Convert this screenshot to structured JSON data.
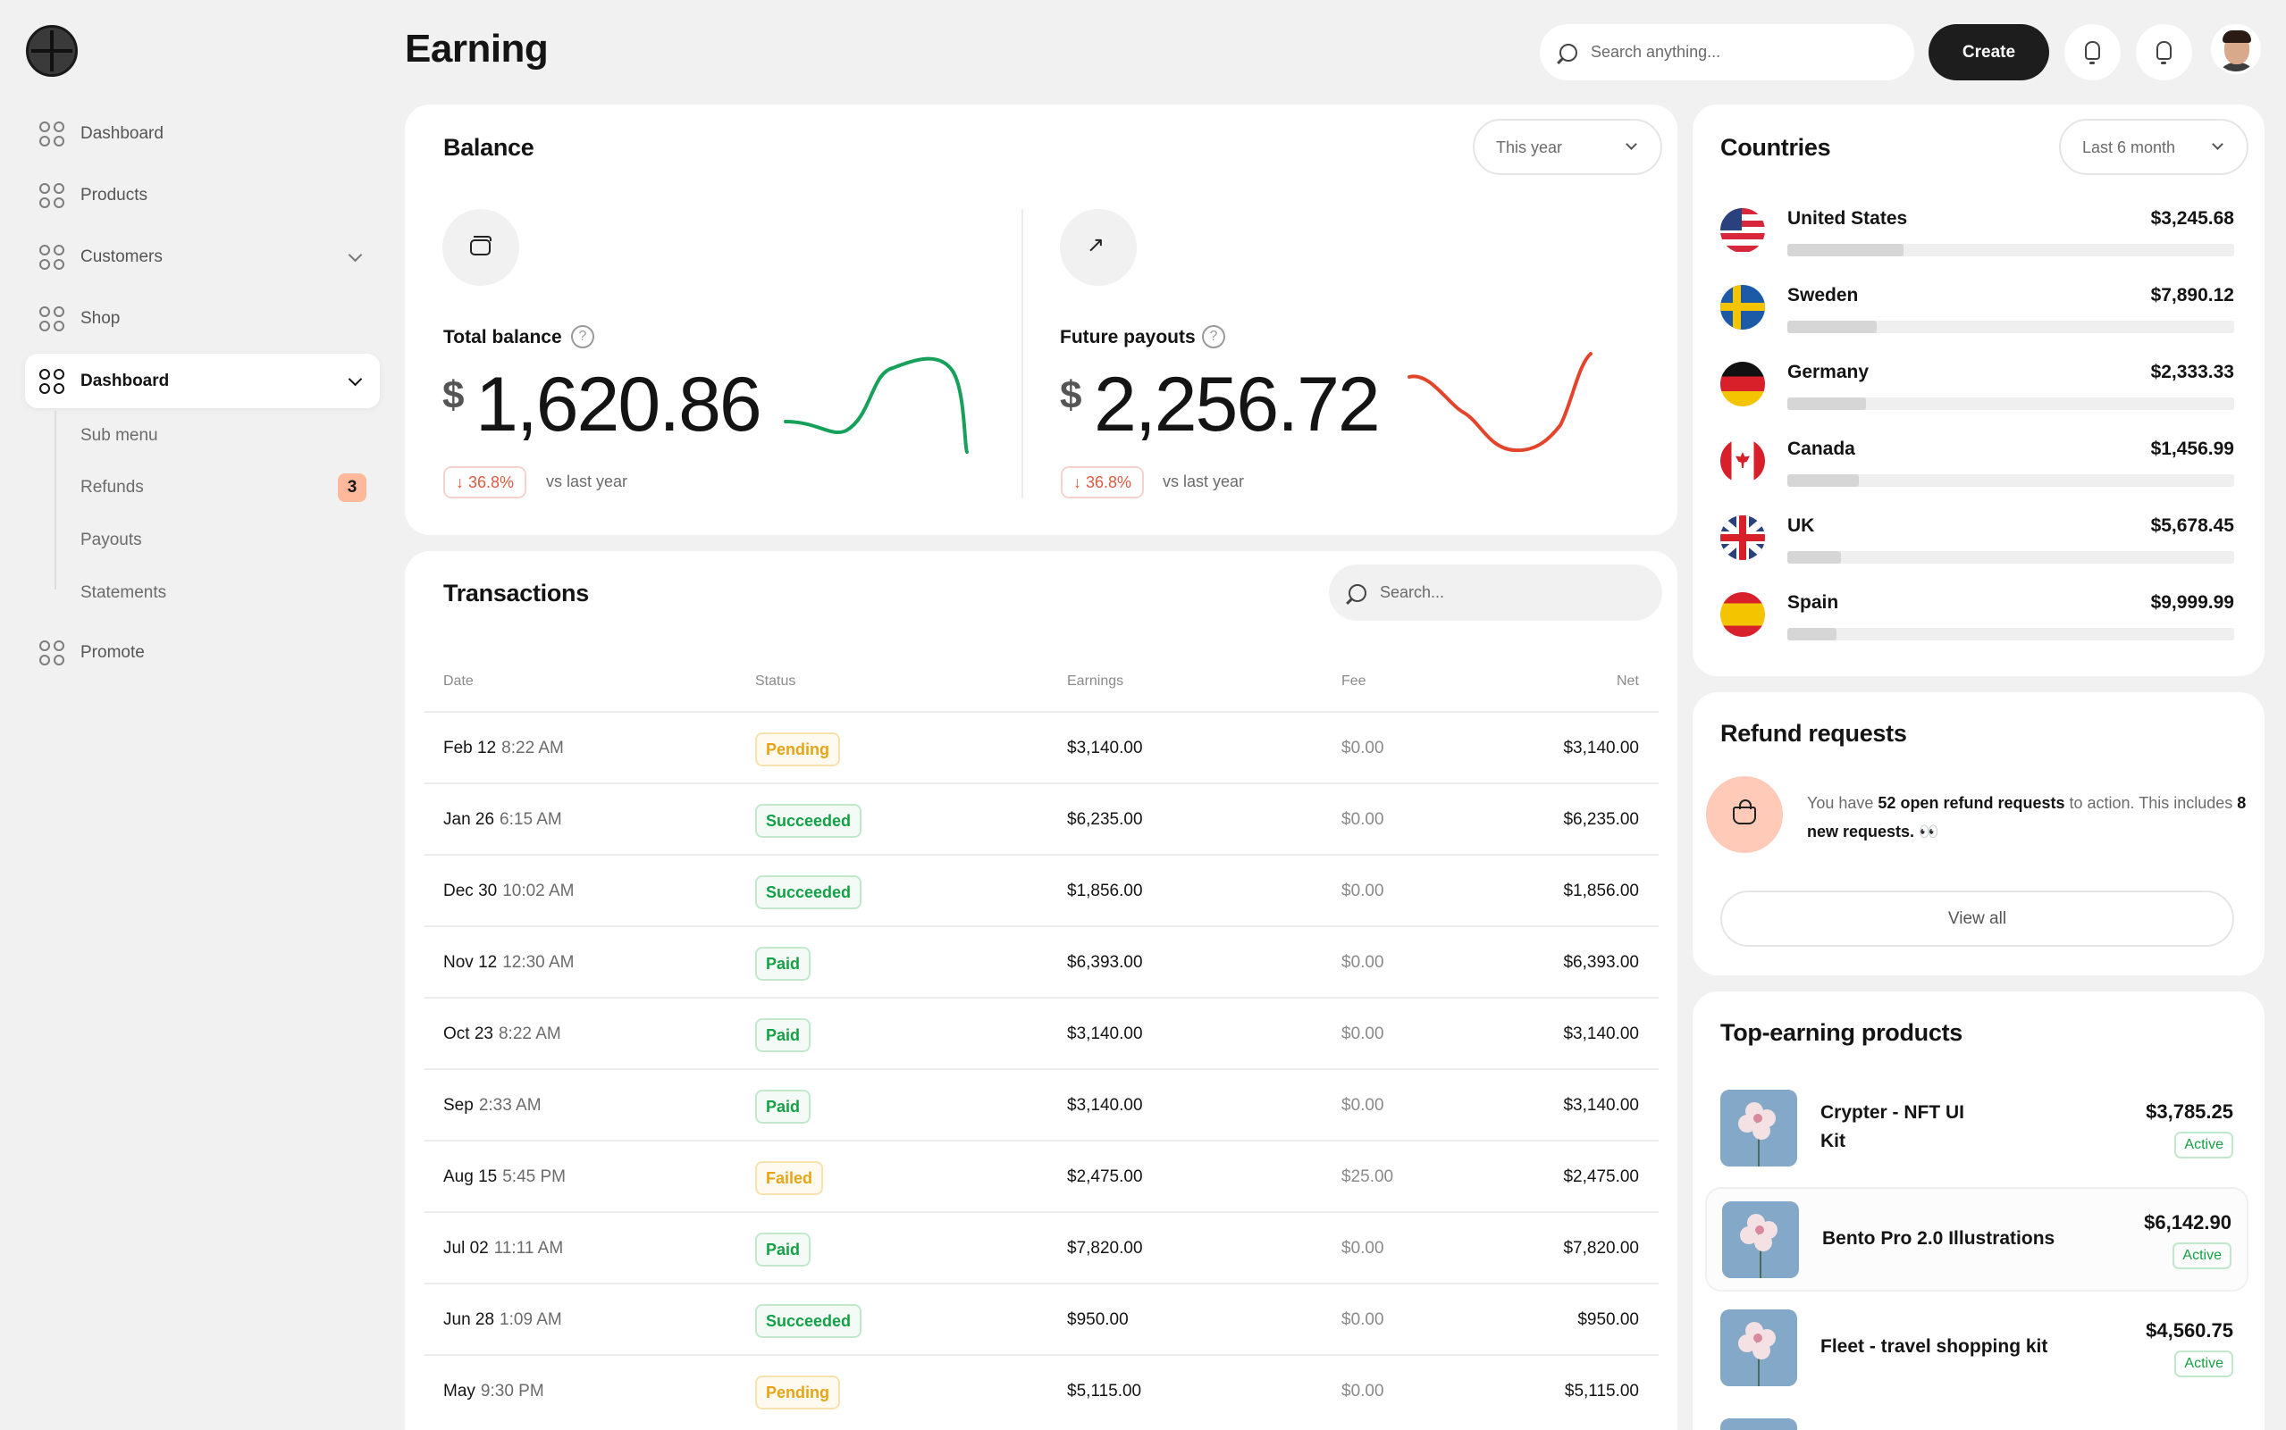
{
  "header": {
    "title": "Earning",
    "search_placeholder": "Search anything...",
    "create_label": "Create"
  },
  "sidebar": {
    "items": [
      {
        "label": "Dashboard"
      },
      {
        "label": "Products"
      },
      {
        "label": "Customers"
      },
      {
        "label": "Shop"
      },
      {
        "label": "Dashboard"
      },
      {
        "label": "Promote"
      }
    ],
    "sub_items": [
      {
        "label": "Sub menu"
      },
      {
        "label": "Refunds",
        "badge": "3"
      },
      {
        "label": "Payouts"
      },
      {
        "label": "Statements"
      }
    ]
  },
  "balance": {
    "title": "Balance",
    "period": "This year",
    "total": {
      "label": "Total balance",
      "currency": "$",
      "value": "1,620.86",
      "delta": "36.8%",
      "delta_arrow": "↓",
      "compare": "vs last year"
    },
    "future": {
      "label": "Future payouts",
      "currency": "$",
      "value": "2,256.72",
      "delta": "36.8%",
      "delta_arrow": "↓",
      "compare": "vs last year"
    },
    "colors": {
      "total_line": "#16a05a",
      "future_line": "#e3452c"
    }
  },
  "transactions": {
    "title": "Transactions",
    "search_placeholder": "Search...",
    "columns": [
      "Date",
      "Status",
      "Earnings",
      "Fee",
      "Net"
    ],
    "rows": [
      {
        "date": "Feb 12",
        "time": "8:22 AM",
        "status": "Pending",
        "kind": "pending",
        "earnings": "$3,140.00",
        "fee": "$0.00",
        "net": "$3,140.00"
      },
      {
        "date": "Jan 26",
        "time": "6:15 AM",
        "status": "Succeeded",
        "kind": "ok",
        "earnings": "$6,235.00",
        "fee": "$0.00",
        "net": "$6,235.00"
      },
      {
        "date": "Dec 30",
        "time": "10:02 AM",
        "status": "Succeeded",
        "kind": "ok",
        "earnings": "$1,856.00",
        "fee": "$0.00",
        "net": "$1,856.00"
      },
      {
        "date": "Nov 12",
        "time": "12:30 AM",
        "status": "Paid",
        "kind": "ok",
        "earnings": "$6,393.00",
        "fee": "$0.00",
        "net": "$6,393.00"
      },
      {
        "date": "Oct 23",
        "time": "8:22 AM",
        "status": "Paid",
        "kind": "ok",
        "earnings": "$3,140.00",
        "fee": "$0.00",
        "net": "$3,140.00"
      },
      {
        "date": "Sep",
        "time": "2:33 AM",
        "status": "Paid",
        "kind": "ok",
        "earnings": "$3,140.00",
        "fee": "$0.00",
        "net": "$3,140.00"
      },
      {
        "date": "Aug 15",
        "time": "5:45 PM",
        "status": "Failed",
        "kind": "failed",
        "earnings": "$2,475.00",
        "fee": "$25.00",
        "net": "$2,475.00"
      },
      {
        "date": "Jul 02",
        "time": "11:11 AM",
        "status": "Paid",
        "kind": "ok",
        "earnings": "$7,820.00",
        "fee": "$0.00",
        "net": "$7,820.00"
      },
      {
        "date": "Jun 28",
        "time": "1:09 AM",
        "status": "Succeeded",
        "kind": "ok",
        "earnings": "$950.00",
        "fee": "$0.00",
        "net": "$950.00"
      },
      {
        "date": "May",
        "time": "9:30 PM",
        "status": "Pending",
        "kind": "pending",
        "earnings": "$5,115.00",
        "fee": "$0.00",
        "net": "$5,115.00"
      }
    ]
  },
  "countries": {
    "title": "Countries",
    "period": "Last 6 month",
    "items": [
      {
        "name": "United States",
        "value": "$3,245.68",
        "share": 0.26,
        "flag": "us-flag"
      },
      {
        "name": "Sweden",
        "value": "$7,890.12",
        "share": 0.2,
        "flag": "sweden-flag"
      },
      {
        "name": "Germany",
        "value": "$2,333.33",
        "share": 0.175,
        "flag": "germany-flag"
      },
      {
        "name": "Canada",
        "value": "$1,456.99",
        "share": 0.16,
        "flag": "canada-flag"
      },
      {
        "name": "UK",
        "value": "$5,678.45",
        "share": 0.12,
        "flag": "uk-flag"
      },
      {
        "name": "Spain",
        "value": "$9,999.99",
        "share": 0.11,
        "flag": "spain-flag"
      }
    ]
  },
  "refunds": {
    "title": "Refund requests",
    "text_pre": "You have ",
    "count_text": "52 open refund requests",
    "text_mid": " to action. This includes ",
    "new_text": "8 new requests.",
    "emoji": "👀",
    "button": "View all"
  },
  "products": {
    "title": "Top-earning products",
    "items": [
      {
        "name": "Crypter - NFT UI Kit",
        "price": "$3,785.25",
        "status": "Active"
      },
      {
        "name": "Bento Pro 2.0 Illustrations",
        "price": "$6,142.90",
        "status": "Active"
      },
      {
        "name": "Fleet - travel shopping kit",
        "price": "$4,560.75",
        "status": "Active"
      }
    ]
  }
}
